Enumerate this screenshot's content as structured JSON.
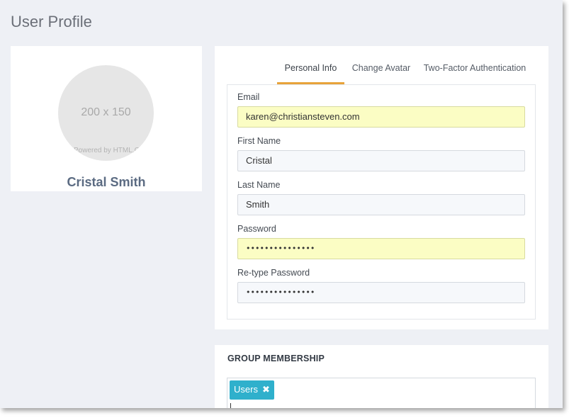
{
  "page": {
    "title": "User Profile"
  },
  "profile": {
    "avatar_placeholder": "200 x 150",
    "avatar_watermark": "Powered by HTML.COM",
    "name": "Cristal Smith"
  },
  "tabs": [
    {
      "label": "Personal Info",
      "active": true
    },
    {
      "label": "Change Avatar",
      "active": false
    },
    {
      "label": "Two-Factor Authentication",
      "active": false
    }
  ],
  "form": {
    "email": {
      "label": "Email",
      "value": "karen@christiansteven.com"
    },
    "first_name": {
      "label": "First Name",
      "value": "Cristal"
    },
    "last_name": {
      "label": "Last Name",
      "value": "Smith"
    },
    "password": {
      "label": "Password",
      "value": "•••••••••••••••"
    },
    "retype_password": {
      "label": "Re-type Password",
      "value": "•••••••••••••••"
    }
  },
  "group_membership": {
    "title": "GROUP MEMBERSHIP",
    "tags": [
      {
        "label": "Users",
        "remove_icon": "✖"
      }
    ]
  },
  "colors": {
    "background": "#eef0f5",
    "accent_tab": "#e8a33a",
    "autofill": "#fbfdc4",
    "tag": "#2fb0cc",
    "name_text": "#5b6b82"
  }
}
